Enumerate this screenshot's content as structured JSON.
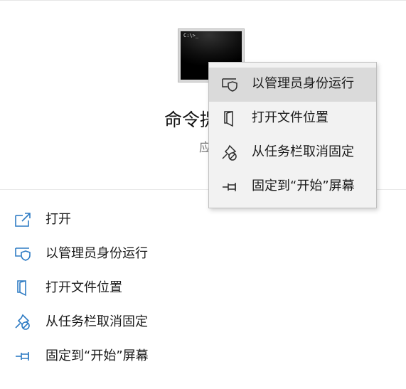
{
  "app": {
    "title": "命令提示符",
    "subtitle": "应用",
    "icon": "command-prompt-icon",
    "icon_prompt_text": "C:\\>_"
  },
  "actions": [
    {
      "label": "打开",
      "icon": "open-external-icon"
    },
    {
      "label": "以管理员身份运行",
      "icon": "run-as-admin-shield-icon"
    },
    {
      "label": "打开文件位置",
      "icon": "file-location-icon"
    },
    {
      "label": "从任务栏取消固定",
      "icon": "unpin-icon"
    },
    {
      "label": "固定到“开始”屏幕",
      "icon": "pin-icon"
    }
  ],
  "context_menu": {
    "items": [
      {
        "label": "以管理员身份运行",
        "icon": "run-as-admin-shield-icon",
        "highlighted": true
      },
      {
        "label": "打开文件位置",
        "icon": "file-location-icon"
      },
      {
        "label": "从任务栏取消固定",
        "icon": "unpin-icon"
      },
      {
        "label": "固定到“开始”屏幕",
        "icon": "pin-icon"
      }
    ]
  },
  "colors": {
    "accent": "#2f7cc4",
    "menu_bg": "#f2f2f2",
    "menu_hover": "#dadada",
    "icon_dark": "#2b2b2b"
  }
}
